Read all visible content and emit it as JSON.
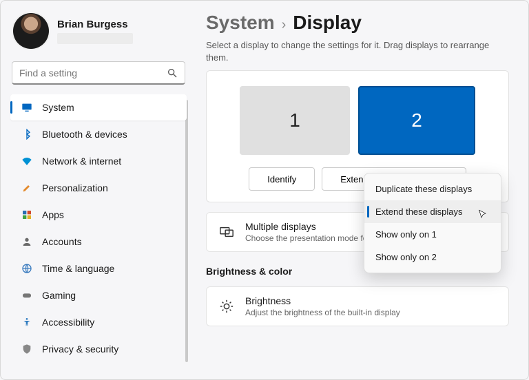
{
  "user": {
    "name": "Brian Burgess"
  },
  "search": {
    "placeholder": "Find a setting"
  },
  "nav": [
    {
      "label": "System"
    },
    {
      "label": "Bluetooth & devices"
    },
    {
      "label": "Network & internet"
    },
    {
      "label": "Personalization"
    },
    {
      "label": "Apps"
    },
    {
      "label": "Accounts"
    },
    {
      "label": "Time & language"
    },
    {
      "label": "Gaming"
    },
    {
      "label": "Accessibility"
    },
    {
      "label": "Privacy & security"
    }
  ],
  "breadcrumb": {
    "parent": "System",
    "current": "Display"
  },
  "hint": "Select a display to change the settings for it. Drag displays to rearrange them.",
  "monitors": {
    "one": "1",
    "two": "2"
  },
  "actions": {
    "identify": "Identify",
    "mode": "Extend these displays"
  },
  "dropdown": {
    "opt0": "Duplicate these displays",
    "opt1": "Extend these displays",
    "opt2": "Show only on 1",
    "opt3": "Show only on 2"
  },
  "multi": {
    "title": "Multiple displays",
    "sub": "Choose the presentation mode for"
  },
  "section_brightness": "Brightness & color",
  "brightness": {
    "title": "Brightness",
    "sub": "Adjust the brightness of the built-in display"
  }
}
